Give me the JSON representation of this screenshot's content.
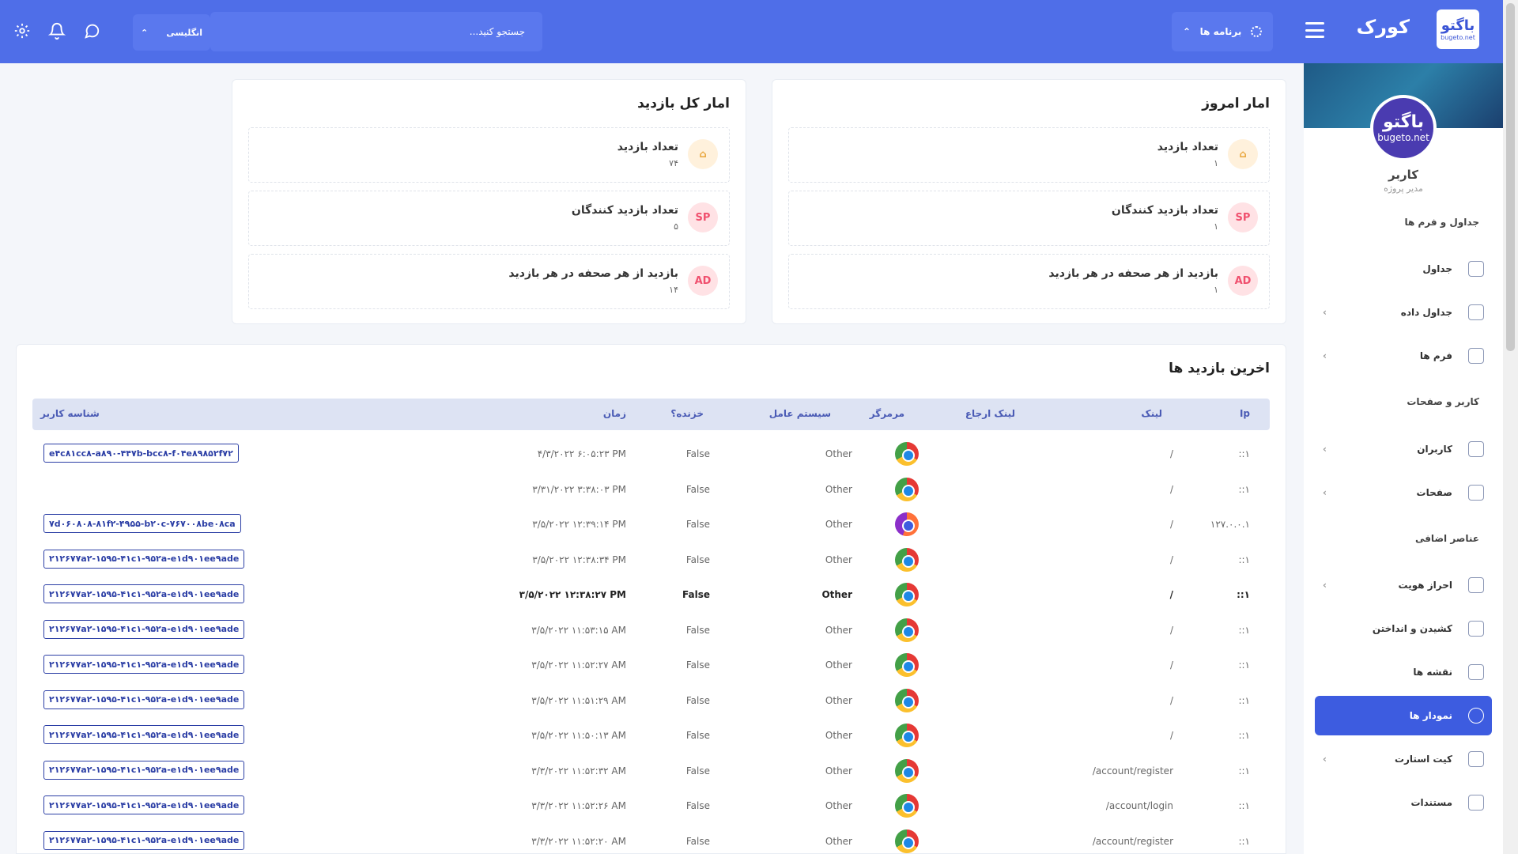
{
  "header": {
    "logo_text": "باگتو",
    "logo_sub": "bugeto.net",
    "brand": "کورک",
    "apps_label": "برنامه ها",
    "search_placeholder": "جستجو کنید...",
    "language": "انگلیسی"
  },
  "sidebar": {
    "profile": {
      "avatar_text": "باگتو",
      "avatar_sub": "bugeto.net",
      "name": "کاربر",
      "role": "مدیر پروژه"
    },
    "groups": {
      "tables_forms": "جداول و فرم ها",
      "user_pages": "کاربر و صفحات",
      "extras": "عناصر اضافی"
    },
    "items": [
      {
        "label": "جداول",
        "icon": "table-icon"
      },
      {
        "label": "جداول داده",
        "icon": "layers-icon"
      },
      {
        "label": "فرم ها",
        "icon": "clipboard-icon"
      },
      {
        "label": "کاربران",
        "icon": "users-icon"
      },
      {
        "label": "صفحات",
        "icon": "file-icon"
      },
      {
        "label": "احراز هویت",
        "icon": "lock-icon"
      },
      {
        "label": "کشیدن و انداختن",
        "icon": "move-icon"
      },
      {
        "label": "نقشه ها",
        "icon": "map-icon"
      },
      {
        "label": "نمودار ها",
        "icon": "pie-chart-icon"
      },
      {
        "label": "کیت استارت",
        "icon": "terminal-icon"
      },
      {
        "label": "مستندات",
        "icon": "book-icon"
      }
    ]
  },
  "today": {
    "title": "امار امروز",
    "stats": [
      {
        "label": "تعداد بازدید",
        "value": "۱",
        "icon": "home-icon"
      },
      {
        "label": "تعداد بازدید کنندگان",
        "value": "۱",
        "badge": "SP"
      },
      {
        "label": "بازدید از هر صحفه در هر بازدید",
        "value": "۱",
        "badge": "AD"
      }
    ]
  },
  "total": {
    "title": "امار کل بازدید",
    "stats": [
      {
        "label": "تعداد بازدید",
        "value": "۷۴",
        "icon": "home-icon"
      },
      {
        "label": "تعداد بازدید کنندگان",
        "value": "۵",
        "badge": "SP"
      },
      {
        "label": "بازدید از هر صحفه در هر بازدید",
        "value": "۱۴",
        "badge": "AD"
      }
    ]
  },
  "visits": {
    "title": "اخرین بازدید ها",
    "columns": {
      "ip": "Ip",
      "link": "لینک",
      "referrer": "لینک ارجاع",
      "browser": "مرمرگر",
      "os": "سیستم عامل",
      "crawler": "خزنده؟",
      "time": "زمان",
      "user_id": "شناسه کاربر"
    },
    "rows": [
      {
        "ip": "::۱",
        "link": "/",
        "browser": "chrome-icon",
        "os": "Other",
        "crawler": "False",
        "time": "۴/۳/۲۰۲۲ ۶:۰۵:۲۳ PM",
        "user_id": "e۴c۸۱cc۸-a۸۹۰-۴۴۷b-bcc۸-f۰۴e۸۹۸۵۲f۷۲"
      },
      {
        "ip": "::۱",
        "link": "/",
        "browser": "chrome-icon",
        "os": "Other",
        "crawler": "False",
        "time": "۳/۳۱/۲۰۲۲ ۳:۳۸:۰۳ PM",
        "user_id": ""
      },
      {
        "ip": "۱۲۷.۰.۰.۱",
        "link": "/",
        "browser": "firefox-icon",
        "os": "Other",
        "crawler": "False",
        "time": "۳/۵/۲۰۲۲ ۱۲:۳۹:۱۴ PM",
        "user_id": "۷d۰۶۰۸۰۸-۸۱f۲-۴۹۵۵-b۲۰c-۷۶۷۰۰۸be۰۸ca"
      },
      {
        "ip": "::۱",
        "link": "/",
        "browser": "chrome-icon",
        "os": "Other",
        "crawler": "False",
        "time": "۳/۵/۲۰۲۲ ۱۲:۳۸:۳۴ PM",
        "user_id": "۲۱۲۶۷۷a۲-۱۵۹۵-۴۱c۱-۹۵۲a-e۱d۹۰۱ee۹ade"
      },
      {
        "ip": "::۱",
        "link": "/",
        "browser": "chrome-icon",
        "os": "Other",
        "crawler": "False",
        "time": "۳/۵/۲۰۲۲ ۱۲:۳۸:۲۷ PM",
        "user_id": "۲۱۲۶۷۷a۲-۱۵۹۵-۴۱c۱-۹۵۲a-e۱d۹۰۱ee۹ade",
        "bold": true
      },
      {
        "ip": "::۱",
        "link": "/",
        "browser": "chrome-icon",
        "os": "Other",
        "crawler": "False",
        "time": "۳/۵/۲۰۲۲ ۱۱:۵۳:۱۵ AM",
        "user_id": "۲۱۲۶۷۷a۲-۱۵۹۵-۴۱c۱-۹۵۲a-e۱d۹۰۱ee۹ade"
      },
      {
        "ip": "::۱",
        "link": "/",
        "browser": "chrome-icon",
        "os": "Other",
        "crawler": "False",
        "time": "۳/۵/۲۰۲۲ ۱۱:۵۲:۲۷ AM",
        "user_id": "۲۱۲۶۷۷a۲-۱۵۹۵-۴۱c۱-۹۵۲a-e۱d۹۰۱ee۹ade"
      },
      {
        "ip": "::۱",
        "link": "/",
        "browser": "chrome-icon",
        "os": "Other",
        "crawler": "False",
        "time": "۳/۵/۲۰۲۲ ۱۱:۵۱:۲۹ AM",
        "user_id": "۲۱۲۶۷۷a۲-۱۵۹۵-۴۱c۱-۹۵۲a-e۱d۹۰۱ee۹ade"
      },
      {
        "ip": "::۱",
        "link": "/",
        "browser": "chrome-icon",
        "os": "Other",
        "crawler": "False",
        "time": "۳/۵/۲۰۲۲ ۱۱:۵۰:۱۳ AM",
        "user_id": "۲۱۲۶۷۷a۲-۱۵۹۵-۴۱c۱-۹۵۲a-e۱d۹۰۱ee۹ade"
      },
      {
        "ip": "::۱",
        "link": "/account/register",
        "browser": "chrome-icon",
        "os": "Other",
        "crawler": "False",
        "time": "۳/۳/۲۰۲۲ ۱۱:۵۲:۳۲ AM",
        "user_id": "۲۱۲۶۷۷a۲-۱۵۹۵-۴۱c۱-۹۵۲a-e۱d۹۰۱ee۹ade"
      },
      {
        "ip": "::۱",
        "link": "/account/login",
        "browser": "chrome-icon",
        "os": "Other",
        "crawler": "False",
        "time": "۳/۳/۲۰۲۲ ۱۱:۵۲:۲۶ AM",
        "user_id": "۲۱۲۶۷۷a۲-۱۵۹۵-۴۱c۱-۹۵۲a-e۱d۹۰۱ee۹ade"
      },
      {
        "ip": "::۱",
        "link": "/account/register",
        "browser": "chrome-icon",
        "os": "Other",
        "crawler": "False",
        "time": "۳/۳/۲۰۲۲ ۱۱:۵۲:۲۰ AM",
        "user_id": "۲۱۲۶۷۷a۲-۱۵۹۵-۴۱c۱-۹۵۲a-e۱d۹۰۱ee۹ade"
      }
    ]
  },
  "colors": {
    "primary": "#4f6ee8",
    "active_nav": "#3d5ce0",
    "tag_border": "#2b3ea5"
  }
}
